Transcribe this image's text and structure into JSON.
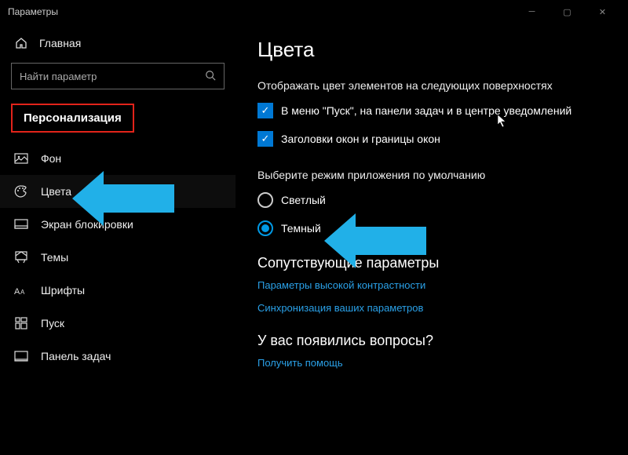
{
  "window": {
    "title": "Параметры"
  },
  "home_label": "Главная",
  "search": {
    "placeholder": "Найти параметр"
  },
  "category": "Персонализация",
  "nav": [
    {
      "label": "Фон"
    },
    {
      "label": "Цвета"
    },
    {
      "label": "Экран блокировки"
    },
    {
      "label": "Темы"
    },
    {
      "label": "Шрифты"
    },
    {
      "label": "Пуск"
    },
    {
      "label": "Панель задач"
    }
  ],
  "page": {
    "title": "Цвета",
    "surfaces_label": "Отображать цвет элементов на следующих поверхностях",
    "check1": "В меню \"Пуск\", на панели задач и в центре уведомлений",
    "check2": "Заголовки окон и границы окон",
    "appmode_label": "Выберите режим приложения по умолчанию",
    "radio_light": "Светлый",
    "radio_dark": "Темный",
    "related_heading": "Сопутствующие параметры",
    "link_contrast": "Параметры высокой контрастности",
    "link_sync": "Синхронизация ваших параметров",
    "questions_heading": "У вас появились вопросы?",
    "link_help": "Получить помощь"
  },
  "accent": "#21b0e8"
}
